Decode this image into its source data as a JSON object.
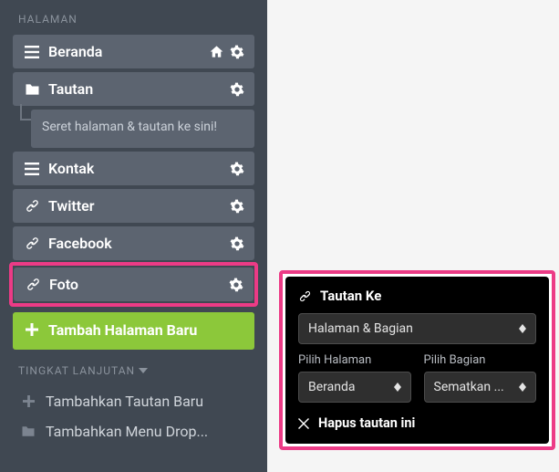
{
  "sidebar": {
    "section_label": "HALAMAN",
    "items": [
      {
        "label": "Beranda",
        "icon": "menu",
        "home": true
      },
      {
        "label": "Tautan",
        "icon": "folder"
      }
    ],
    "drop_hint": "Seret halaman & tautan ke sini!",
    "items2": [
      {
        "label": "Kontak",
        "icon": "menu"
      },
      {
        "label": "Twitter",
        "icon": "link"
      },
      {
        "label": "Facebook",
        "icon": "link"
      }
    ],
    "highlighted": {
      "label": "Foto",
      "icon": "link"
    },
    "add_page_label": "Tambah Halaman Baru",
    "advanced_label": "TINGKAT LANJUTAN",
    "advanced_items": [
      {
        "label": "Tambahkan Tautan Baru",
        "icon": "plus"
      },
      {
        "label": "Tambahkan Menu Drop...",
        "icon": "folder"
      }
    ]
  },
  "popover": {
    "title": "Tautan Ke",
    "main_select": "Halaman & Bagian",
    "col1_label": "Pilih Halaman",
    "col1_value": "Beranda",
    "col2_label": "Pilih Bagian",
    "col2_value": "Sematkan ...",
    "delete_label": "Hapus tautan ini"
  }
}
